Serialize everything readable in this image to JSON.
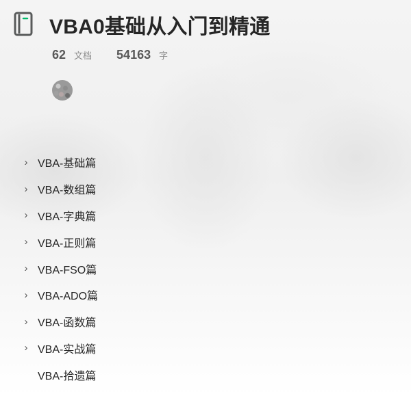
{
  "book": {
    "title": "VBA0基础从入门到精通",
    "doc_count": "62",
    "doc_unit": "文档",
    "word_count": "54163",
    "word_unit": "字"
  },
  "toc": [
    {
      "label": "VBA-基础篇",
      "expandable": true
    },
    {
      "label": "VBA-数组篇",
      "expandable": true
    },
    {
      "label": "VBA-字典篇",
      "expandable": true
    },
    {
      "label": "VBA-正则篇",
      "expandable": true
    },
    {
      "label": "VBA-FSO篇",
      "expandable": true
    },
    {
      "label": "VBA-ADO篇",
      "expandable": true
    },
    {
      "label": "VBA-函数篇",
      "expandable": true
    },
    {
      "label": "VBA-实战篇",
      "expandable": true
    },
    {
      "label": "VBA-拾遗篇",
      "expandable": false
    }
  ],
  "icons": {
    "book": "book-icon",
    "expand": "chevron-right-icon"
  },
  "colors": {
    "book_accent": "#00b96b",
    "text_primary": "#262626",
    "text_secondary": "#8c8c8c"
  }
}
